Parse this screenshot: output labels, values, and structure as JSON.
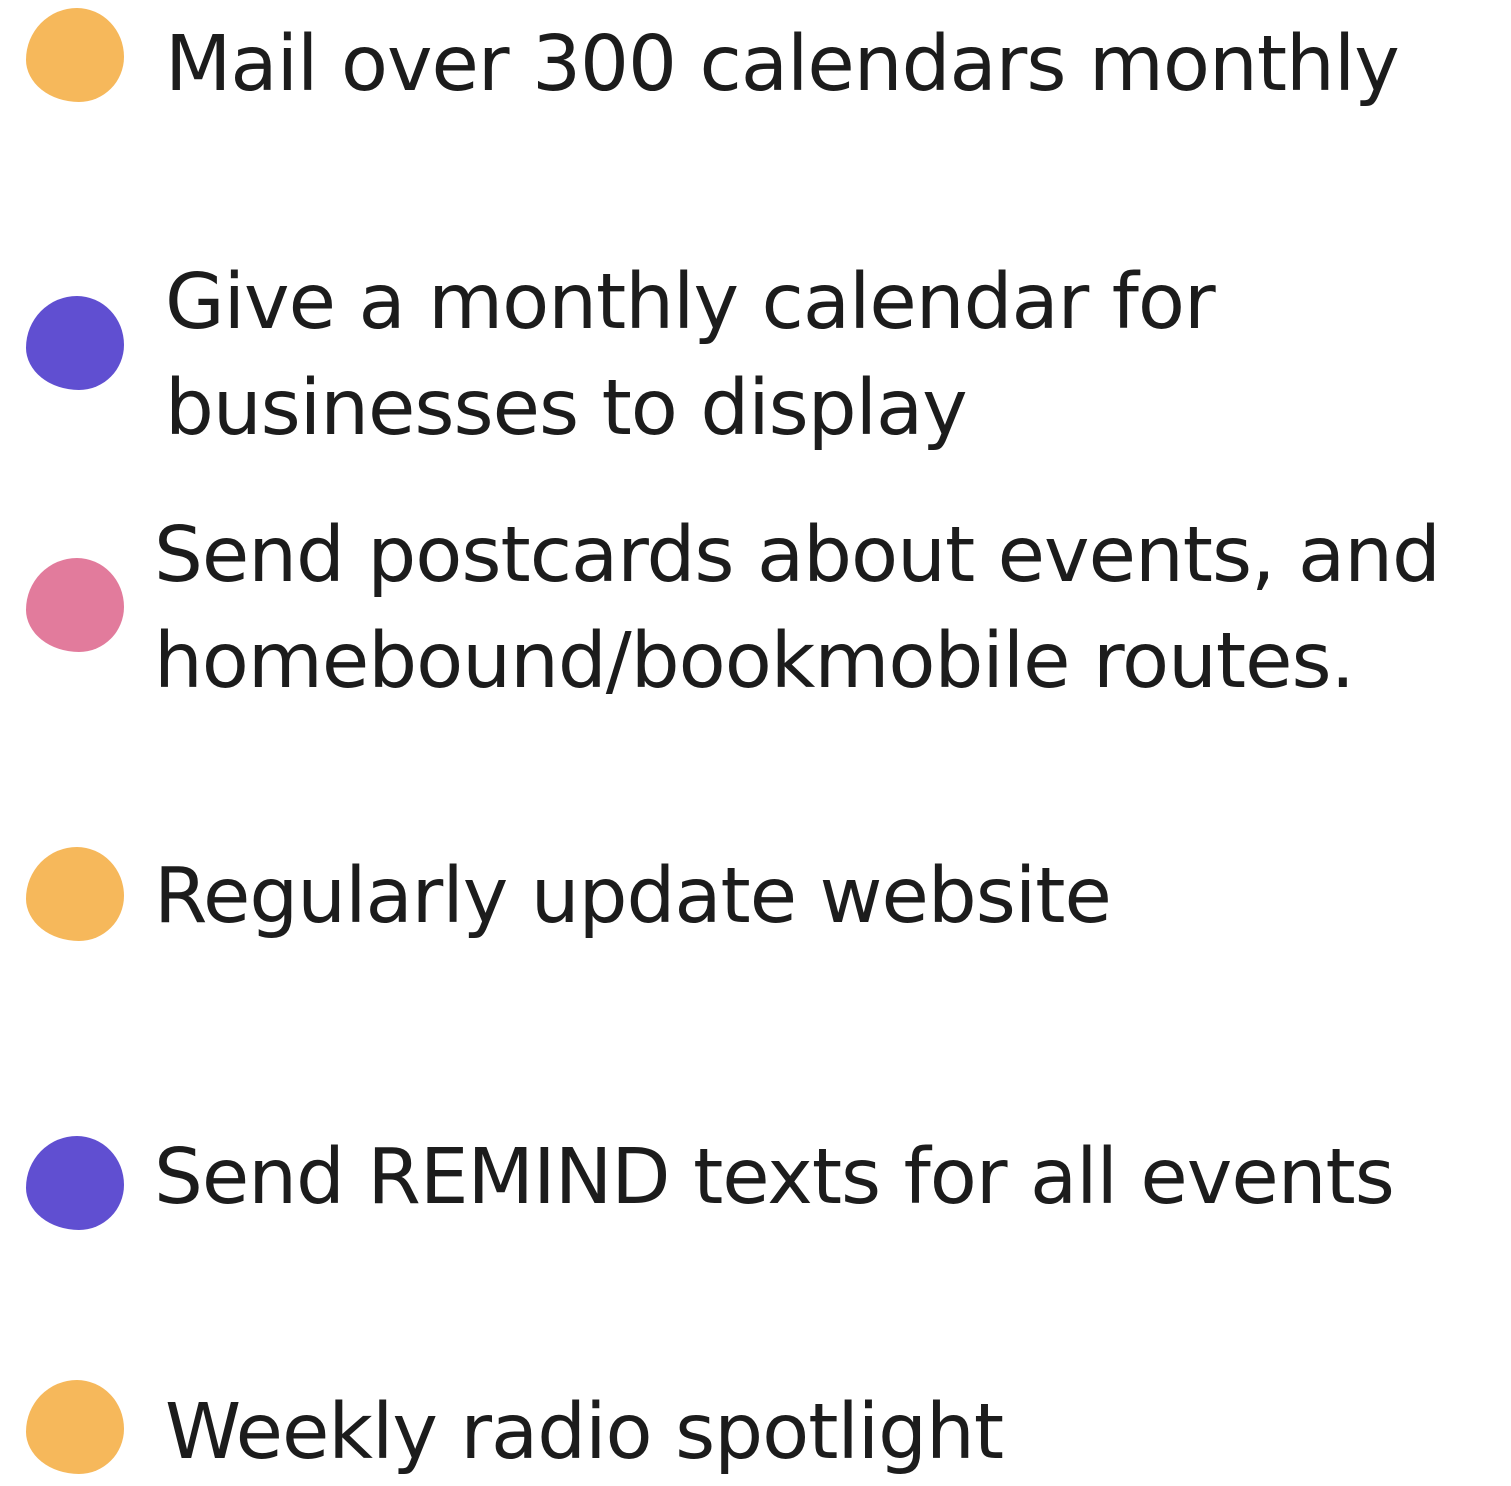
{
  "items": [
    {
      "text": "Mail over 300 calendars monthly",
      "color": "#f6b85b"
    },
    {
      "text": "Give a monthly calendar for\nbusinesses to display",
      "color": "#604fd1"
    },
    {
      "text": "Send postcards about events, and\nhomebound/bookmobile routes.",
      "color": "#e27b9c"
    },
    {
      "text": "Regularly update website",
      "color": "#f6b85b"
    },
    {
      "text": "Send REMIND texts for all events",
      "color": "#604fd1"
    },
    {
      "text": "Weekly radio spotlight",
      "color": "#f6b85b"
    }
  ]
}
